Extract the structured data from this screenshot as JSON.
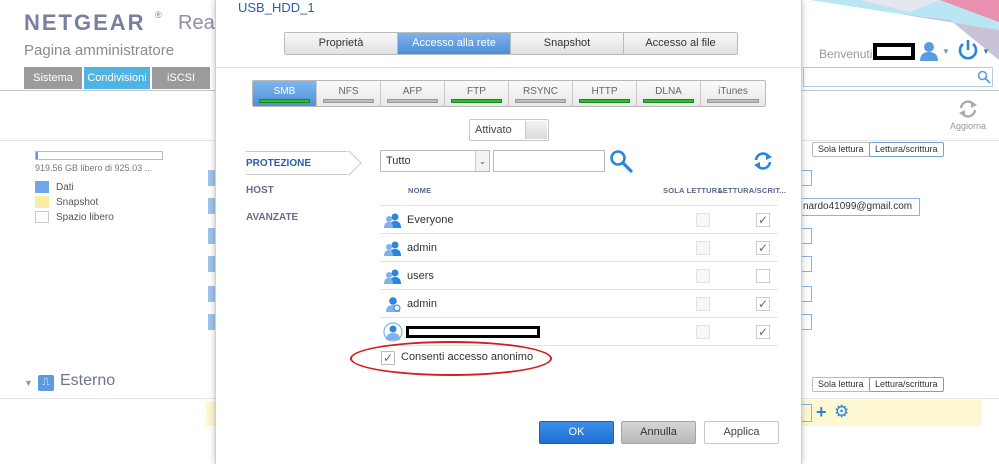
{
  "background": {
    "brand": "NETGEAR",
    "brand_suffix": "Rea",
    "admin_title": "Pagina amministratore",
    "nav_tabs": [
      "Sistema",
      "Condivisioni",
      "iSCSI"
    ],
    "storage_free": "919.56 GB libero di 925.03 ...",
    "legend": [
      "Dati",
      "Snapshot",
      "Spazio libero"
    ],
    "section_external": "Esterno",
    "welcome": "Benvenuti",
    "refresh_label": "Aggiorna",
    "email_value": "nardo41099@gmail.com",
    "read_only_label": "Sola lettura",
    "read_write_label": "Lettura/scrittura",
    "colors": {
      "brand": "#7a7fa0",
      "tab_active": "#4fb4e3",
      "tab_inactive": "#9b9b9b"
    }
  },
  "dialog": {
    "title": "USB_HDD_1",
    "top_tabs": [
      {
        "label": "Proprietà",
        "active": false
      },
      {
        "label": "Accesso alla rete",
        "active": true
      },
      {
        "label": "Snapshot",
        "active": false
      },
      {
        "label": "Accesso al file",
        "active": false
      }
    ],
    "protocols": [
      {
        "label": "SMB",
        "active": true,
        "enabled": true
      },
      {
        "label": "NFS",
        "active": false,
        "enabled": false
      },
      {
        "label": "AFP",
        "active": false,
        "enabled": false
      },
      {
        "label": "FTP",
        "active": false,
        "enabled": true
      },
      {
        "label": "RSYNC",
        "active": false,
        "enabled": false
      },
      {
        "label": "HTTP",
        "active": false,
        "enabled": true
      },
      {
        "label": "DLNA",
        "active": false,
        "enabled": true
      },
      {
        "label": "iTunes",
        "active": false,
        "enabled": false
      }
    ],
    "status_toggle": "Attivato",
    "side_nav": [
      {
        "label": "PROTEZIONE",
        "active": true
      },
      {
        "label": "HOST",
        "active": false
      },
      {
        "label": "AVANZATE",
        "active": false
      }
    ],
    "filter_value": "Tutto",
    "search_value": "",
    "columns": {
      "name": "NOME",
      "read_only": "SOLA LETTURA",
      "read_write": "LETTURA/SCRIT..."
    },
    "users": [
      {
        "name": "Everyone",
        "icon": "group-icon",
        "read_only": false,
        "read_write": true
      },
      {
        "name": "admin",
        "icon": "group-icon",
        "read_only": false,
        "read_write": true
      },
      {
        "name": "users",
        "icon": "group-icon",
        "read_only": false,
        "read_write": false
      },
      {
        "name": "admin",
        "icon": "user-icon",
        "read_only": false,
        "read_write": true
      },
      {
        "name": "",
        "icon": "user-network-icon",
        "read_only": false,
        "read_write": true
      }
    ],
    "anonymous_access_label": "Consenti accesso anonimo",
    "anonymous_access_checked": true,
    "buttons": {
      "ok": "OK",
      "cancel": "Annulla",
      "apply": "Applica"
    },
    "colors": {
      "accent": "#4d8ed8",
      "title": "#2a5ea8",
      "indicator_on": "#2fbd2f",
      "highlight_oval": "#d11e1e"
    }
  }
}
